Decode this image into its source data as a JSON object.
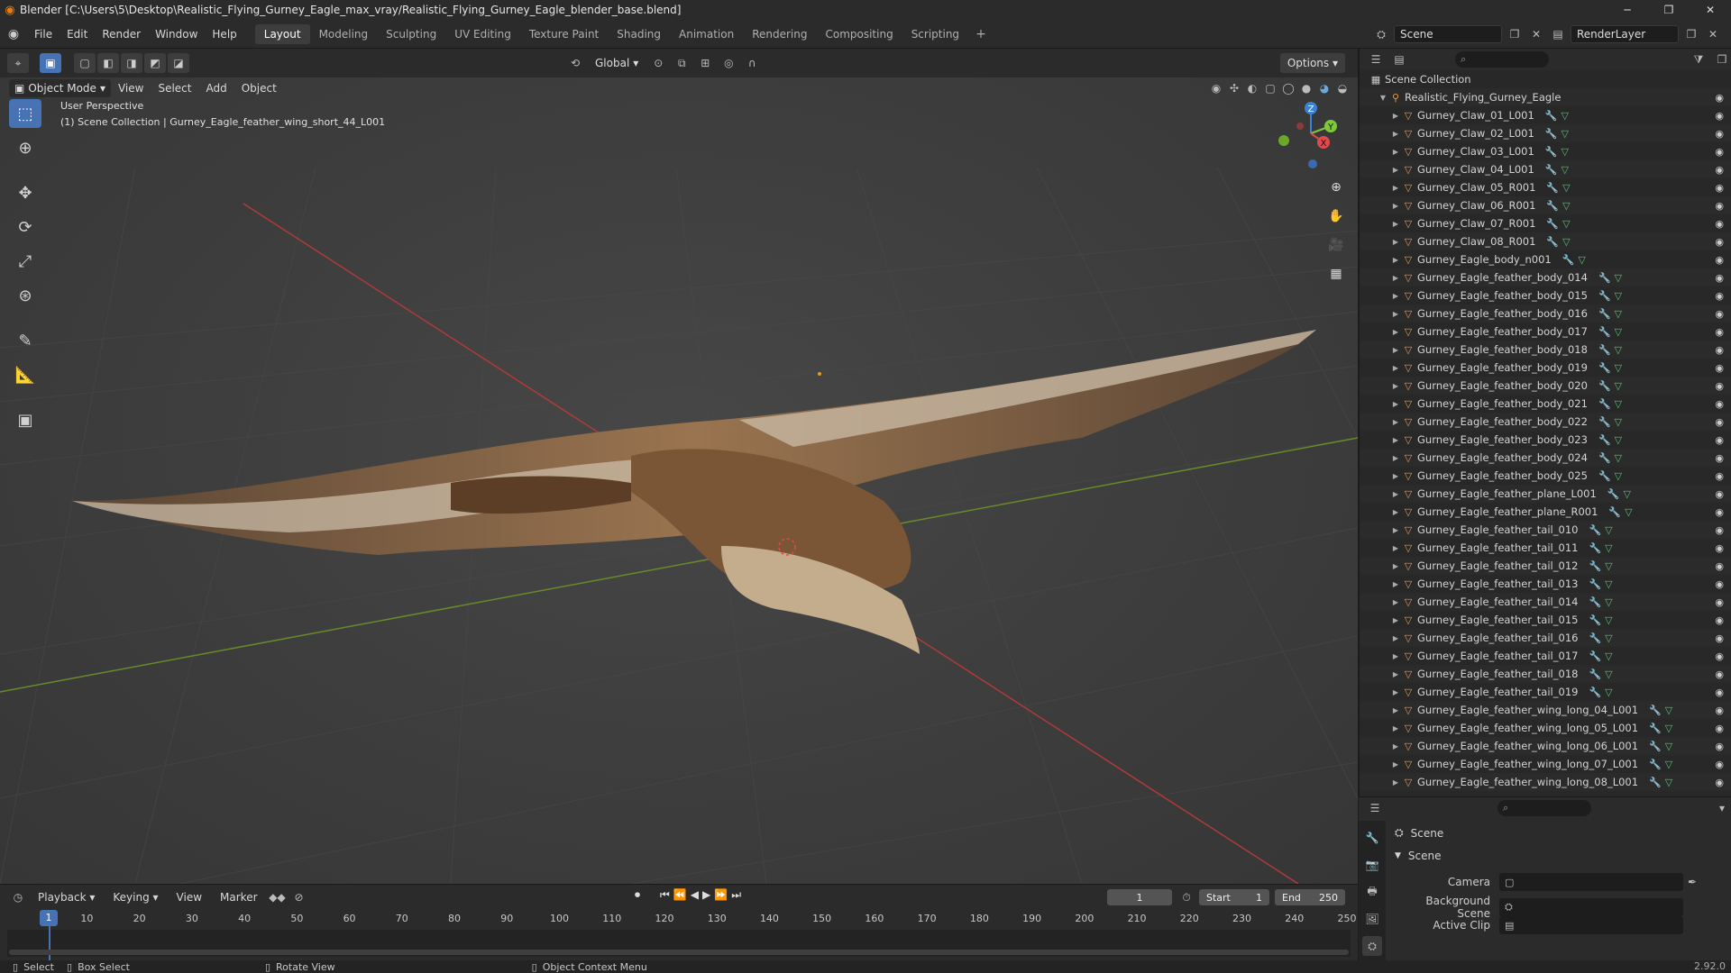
{
  "window": {
    "title": "Blender [C:\\Users\\5\\Desktop\\Realistic_Flying_Gurney_Eagle_max_vray/Realistic_Flying_Gurney_Eagle_blender_base.blend]",
    "minimize": "─",
    "maximize": "❐",
    "close": "✕"
  },
  "menu": [
    "File",
    "Edit",
    "Render",
    "Window",
    "Help"
  ],
  "workspaces": [
    "Layout",
    "Modeling",
    "Sculpting",
    "UV Editing",
    "Texture Paint",
    "Shading",
    "Animation",
    "Rendering",
    "Compositing",
    "Scripting"
  ],
  "active_workspace": "Layout",
  "scene": {
    "name": "Scene",
    "render_layer": "RenderLayer"
  },
  "viewport": {
    "mode": "Object Mode",
    "menus": [
      "View",
      "Select",
      "Add",
      "Object"
    ],
    "orientation": "Global",
    "options_label": "Options",
    "overlay_title": "User Perspective",
    "overlay_subtitle": "(1) Scene Collection | Gurney_Eagle_feather_wing_short_44_L001",
    "gizmo": {
      "x": "X",
      "y": "Y",
      "z": "Z"
    }
  },
  "outliner": {
    "root": "Scene Collection",
    "collection": "Realistic_Flying_Gurney_Eagle",
    "items": [
      "Gurney_Claw_01_L001",
      "Gurney_Claw_02_L001",
      "Gurney_Claw_03_L001",
      "Gurney_Claw_04_L001",
      "Gurney_Claw_05_R001",
      "Gurney_Claw_06_R001",
      "Gurney_Claw_07_R001",
      "Gurney_Claw_08_R001",
      "Gurney_Eagle_body_n001",
      "Gurney_Eagle_feather_body_014",
      "Gurney_Eagle_feather_body_015",
      "Gurney_Eagle_feather_body_016",
      "Gurney_Eagle_feather_body_017",
      "Gurney_Eagle_feather_body_018",
      "Gurney_Eagle_feather_body_019",
      "Gurney_Eagle_feather_body_020",
      "Gurney_Eagle_feather_body_021",
      "Gurney_Eagle_feather_body_022",
      "Gurney_Eagle_feather_body_023",
      "Gurney_Eagle_feather_body_024",
      "Gurney_Eagle_feather_body_025",
      "Gurney_Eagle_feather_plane_L001",
      "Gurney_Eagle_feather_plane_R001",
      "Gurney_Eagle_feather_tail_010",
      "Gurney_Eagle_feather_tail_011",
      "Gurney_Eagle_feather_tail_012",
      "Gurney_Eagle_feather_tail_013",
      "Gurney_Eagle_feather_tail_014",
      "Gurney_Eagle_feather_tail_015",
      "Gurney_Eagle_feather_tail_016",
      "Gurney_Eagle_feather_tail_017",
      "Gurney_Eagle_feather_tail_018",
      "Gurney_Eagle_feather_tail_019",
      "Gurney_Eagle_feather_wing_long_04_L001",
      "Gurney_Eagle_feather_wing_long_05_L001",
      "Gurney_Eagle_feather_wing_long_06_L001",
      "Gurney_Eagle_feather_wing_long_07_L001",
      "Gurney_Eagle_feather_wing_long_08_L001"
    ]
  },
  "properties": {
    "context": "Scene",
    "panel": "Scene",
    "camera_label": "Camera",
    "background_scene_label": "Background Scene",
    "active_clip_label": "Active Clip"
  },
  "timeline": {
    "menus": [
      "Playback",
      "Keying",
      "View",
      "Marker"
    ],
    "current_frame": "1",
    "start_label": "Start",
    "start": "1",
    "end_label": "End",
    "end": "250",
    "ruler": [
      "1",
      "10",
      "20",
      "30",
      "40",
      "50",
      "60",
      "70",
      "80",
      "90",
      "100",
      "110",
      "120",
      "130",
      "140",
      "150",
      "160",
      "170",
      "180",
      "190",
      "200",
      "210",
      "220",
      "230",
      "240",
      "250"
    ]
  },
  "status": {
    "select": "Select",
    "box_select": "Box Select",
    "rotate_view": "Rotate View",
    "context_menu": "Object Context Menu",
    "version": "2.92.0"
  },
  "colors": {
    "accent": "#4772b3",
    "axis_x": "#e04a4a",
    "axis_y": "#7ec83a",
    "axis_z": "#3b82d6",
    "object_icon": "#e89a4a"
  }
}
